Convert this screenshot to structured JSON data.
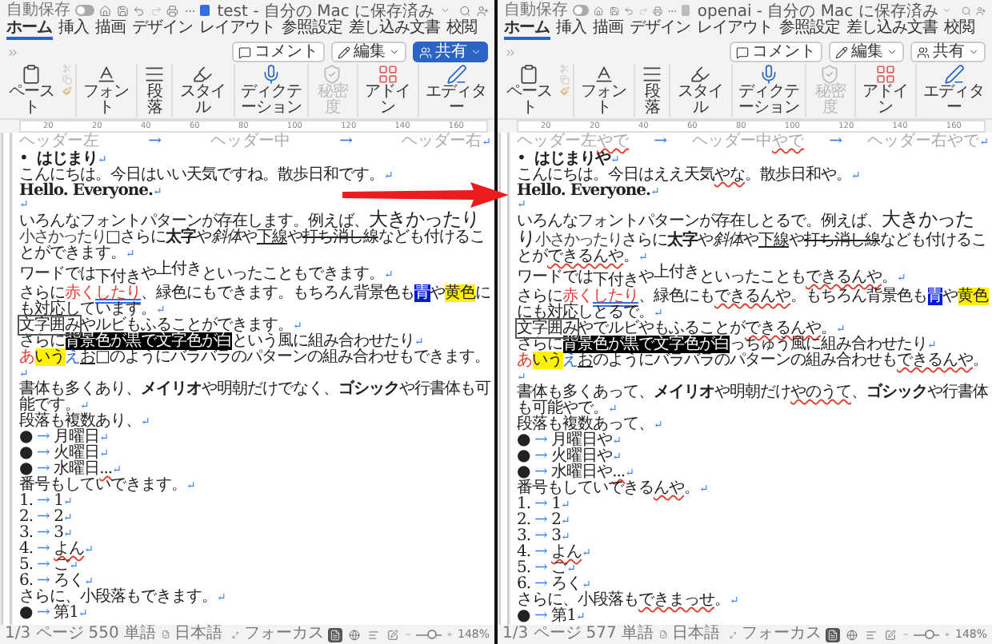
{
  "windows": [
    {
      "autosave_label": "自動保存",
      "autosave_on": false,
      "title": "test - 自分の Mac に保存済み",
      "title_icon_active": true,
      "tabs": [
        {
          "label": "ホーム",
          "selected": true
        },
        {
          "label": "挿入",
          "selected": false
        },
        {
          "label": "描画",
          "selected": false
        },
        {
          "label": "デザイン",
          "selected": false
        },
        {
          "label": "レイアウト",
          "selected": false
        },
        {
          "label": "参照設定",
          "selected": false
        },
        {
          "label": "差し込み文書",
          "selected": false
        },
        {
          "label": "校閲",
          "selected": false
        }
      ],
      "actions": [
        {
          "label": "コメント",
          "kind": "comment",
          "primary": false
        },
        {
          "label": "編集",
          "kind": "edit",
          "primary": false
        },
        {
          "label": "共有",
          "kind": "share",
          "primary": true
        }
      ],
      "ribbon": [
        {
          "label": "ペースト",
          "kind": "paste",
          "disabled": false
        },
        {
          "label": "フォント",
          "kind": "font",
          "disabled": false
        },
        {
          "label": "段落",
          "kind": "paragraph",
          "disabled": false
        },
        {
          "label": "スタイル",
          "kind": "styles",
          "disabled": false
        },
        {
          "label": "ディクテーション",
          "kind": "dictate",
          "disabled": false
        },
        {
          "label": "秘密度",
          "kind": "sensitivity",
          "disabled": true
        },
        {
          "label": "アドイン",
          "kind": "addins",
          "disabled": false
        },
        {
          "label": "エディター",
          "kind": "editor",
          "disabled": false
        }
      ],
      "ruler": [
        "20",
        "20",
        "40",
        "60",
        "80",
        "100",
        "120",
        "140",
        "160"
      ],
      "header": [
        {
          "runs": [
            {
              "text": "ヘッダー左"
            }
          ]
        },
        {
          "runs": [
            {
              "text": "→",
              "blue": true
            }
          ]
        },
        {
          "runs": [
            {
              "text": "ヘッダー中"
            }
          ]
        },
        {
          "runs": [
            {
              "text": "→",
              "blue": true
            }
          ]
        },
        {
          "runs": [
            {
              "text": "ヘッダー右"
            }
          ],
          "mark": "↵"
        }
      ],
      "paragraphs": [
        {
          "kind": "heading",
          "marker": "•",
          "runs": [
            {
              "text": "はじまり",
              "bold": true
            }
          ],
          "mark": "↵"
        },
        {
          "kind": "text",
          "runs": [
            {
              "text": "こんにちは。今日はいい天気ですね。散歩日和です。"
            }
          ],
          "mark": "↵"
        },
        {
          "kind": "text",
          "runs": [
            {
              "text": "Hello. Everyone.",
              "bold": true
            }
          ],
          "mark": "↵"
        },
        {
          "kind": "empty",
          "mark": "↵"
        },
        {
          "kind": "text",
          "runs": [
            {
              "text": "いろんなフォントパターンが存在します。例えば、"
            },
            {
              "text": "大きかったり",
              "big": true
            },
            {
              "text": "小さかったり",
              "small": true
            },
            {
              "text": "□さらに"
            },
            {
              "text": "太字",
              "bold": true
            },
            {
              "text": "や"
            },
            {
              "text": "斜体",
              "italic": true
            },
            {
              "text": "や"
            },
            {
              "text": "下線",
              "underline": true
            },
            {
              "text": "や"
            },
            {
              "text": "打ち消し線",
              "strike": true
            },
            {
              "text": "なども付けることができます。"
            }
          ],
          "mark": "↵"
        },
        {
          "kind": "text",
          "runs": [
            {
              "text": "ワードでは"
            },
            {
              "text": "下付き",
              "sub": true
            },
            {
              "text": "や"
            },
            {
              "text": "上付き",
              "sup": true
            },
            {
              "text": "といったこともできます。"
            }
          ],
          "mark": "↵"
        },
        {
          "kind": "text",
          "runs": [
            {
              "text": "さらに"
            },
            {
              "text": "赤く",
              "red": true
            },
            {
              "text": "したり",
              "red": true,
              "grammar": true
            },
            {
              "text": "、緑色にもできます。もちろん背景色も"
            },
            {
              "text": "青",
              "shade": true
            },
            {
              "text": "や"
            },
            {
              "text": "黄色",
              "highlight": true
            },
            {
              "text": "にも対応しています。"
            }
          ],
          "mark": "↵"
        },
        {
          "kind": "text",
          "runs": [
            {
              "text": "文字囲み",
              "boxed": true
            },
            {
              "text": "やルビもふることができます。"
            }
          ],
          "mark": "↵"
        },
        {
          "kind": "text",
          "runs": [
            {
              "text": "さらに"
            },
            {
              "text": "背景色が黒で文字色が白",
              "inverse": true
            },
            {
              "text": "という風に組み合わせたり"
            }
          ],
          "mark": "↵"
        },
        {
          "kind": "text",
          "runs": [
            {
              "text": "あ",
              "red": true
            },
            {
              "text": "いう",
              "highlight": true
            },
            {
              "text": "え",
              "blue": true
            },
            {
              "text": "お",
              "underline": true
            },
            {
              "text": "□のようにバラバラのパターンの組み合わせもできます。"
            }
          ],
          "mark": "↵"
        },
        {
          "kind": "text",
          "runs": [
            {
              "text": "書体も多くあり、"
            },
            {
              "text": "メイリオ",
              "sans": true
            },
            {
              "text": "や明朝だけでなく、"
            },
            {
              "text": "ゴシック",
              "sans": true
            },
            {
              "text": "や行書体も可能です。"
            }
          ],
          "mark": "↵"
        },
        {
          "kind": "text",
          "runs": [
            {
              "text": "段落も複数あり、"
            }
          ],
          "mark": "↵"
        },
        {
          "kind": "list",
          "marker": "●",
          "tab": "→",
          "runs": [
            {
              "text": "月曜日"
            }
          ],
          "mark": "↵"
        },
        {
          "kind": "list",
          "marker": "●",
          "tab": "→",
          "runs": [
            {
              "text": "火曜日"
            }
          ],
          "mark": "↵"
        },
        {
          "kind": "list",
          "marker": "●",
          "tab": "→",
          "runs": [
            {
              "text": "水曜日"
            },
            {
              "text": "...",
              "squiggle": true
            }
          ],
          "mark": "↵"
        },
        {
          "kind": "text",
          "runs": [
            {
              "text": "番号もしていできます。"
            }
          ],
          "mark": "↵"
        },
        {
          "kind": "list",
          "marker": "1.",
          "tab": "→",
          "runs": [
            {
              "text": "1"
            }
          ],
          "mark": "↵"
        },
        {
          "kind": "list",
          "marker": "2.",
          "tab": "→",
          "runs": [
            {
              "text": "2"
            }
          ],
          "mark": "↵"
        },
        {
          "kind": "list",
          "marker": "3.",
          "tab": "→",
          "runs": [
            {
              "text": "3"
            }
          ],
          "mark": "↵"
        },
        {
          "kind": "list",
          "marker": "4.",
          "tab": "→",
          "runs": [
            {
              "text": "よん",
              "squiggle": true
            }
          ],
          "mark": "↵"
        },
        {
          "kind": "list",
          "marker": "5.",
          "tab": "→",
          "runs": [
            {
              "text": "ご"
            }
          ],
          "mark": "↵"
        },
        {
          "kind": "list",
          "marker": "6.",
          "tab": "→",
          "runs": [
            {
              "text": "ろく"
            }
          ],
          "mark": "↵"
        },
        {
          "kind": "text",
          "runs": [
            {
              "text": "さらに、小段落もできます。"
            }
          ],
          "mark": "↵"
        },
        {
          "kind": "list",
          "marker": "●",
          "tab": "→",
          "runs": [
            {
              "text": "第1"
            }
          ],
          "mark": "↵"
        }
      ],
      "status": {
        "pages": "1/3 ページ",
        "words": "550 単語",
        "language": "日本語",
        "focus": "フォーカス",
        "views": [
          {
            "kind": "print",
            "selected": true
          },
          {
            "kind": "web",
            "selected": false
          },
          {
            "kind": "outline",
            "selected": false
          },
          {
            "kind": "draft",
            "selected": false
          }
        ],
        "zoom": {
          "level": 0.6,
          "reading": "148%"
        }
      }
    },
    {
      "autosave_label": "自動保存",
      "autosave_on": false,
      "title": "openai - 自分の Mac に保存済み",
      "title_icon_active": false,
      "tabs": [
        {
          "label": "ホーム",
          "selected": true
        },
        {
          "label": "挿入",
          "selected": false
        },
        {
          "label": "描画",
          "selected": false
        },
        {
          "label": "デザイン",
          "selected": false
        },
        {
          "label": "レイアウト",
          "selected": false
        },
        {
          "label": "参照設定",
          "selected": false
        },
        {
          "label": "差し込み文書",
          "selected": false
        },
        {
          "label": "校閲",
          "selected": false
        }
      ],
      "actions": [
        {
          "label": "コメント",
          "kind": "comment",
          "primary": false
        },
        {
          "label": "編集",
          "kind": "edit",
          "primary": false
        },
        {
          "label": "共有",
          "kind": "share",
          "primary": false
        }
      ],
      "ribbon": [
        {
          "label": "ペースト",
          "kind": "paste",
          "disabled": false
        },
        {
          "label": "フォント",
          "kind": "font",
          "disabled": false
        },
        {
          "label": "段落",
          "kind": "paragraph",
          "disabled": false
        },
        {
          "label": "スタイル",
          "kind": "styles",
          "disabled": false
        },
        {
          "label": "ディクテーション",
          "kind": "dictate",
          "disabled": false
        },
        {
          "label": "秘密度",
          "kind": "sensitivity",
          "disabled": true
        },
        {
          "label": "アドイン",
          "kind": "addins",
          "disabled": false
        },
        {
          "label": "エディター",
          "kind": "editor",
          "disabled": false
        }
      ],
      "ruler": [
        "20",
        "20",
        "40",
        "60",
        "80",
        "100",
        "120",
        "140",
        "160"
      ],
      "header": [
        {
          "runs": [
            {
              "text": "ヘッダー左"
            },
            {
              "text": "やで",
              "squiggle": true
            }
          ]
        },
        {
          "runs": [
            {
              "text": "→",
              "blue": true
            }
          ]
        },
        {
          "runs": [
            {
              "text": "ヘッダー中"
            },
            {
              "text": "やで",
              "squiggle": true
            }
          ]
        },
        {
          "runs": [
            {
              "text": "→",
              "blue": true
            }
          ]
        },
        {
          "runs": [
            {
              "text": "ヘッダー右やで"
            }
          ],
          "mark": "↵"
        }
      ],
      "paragraphs": [
        {
          "kind": "heading",
          "marker": "•",
          "runs": [
            {
              "text": "はじまりや",
              "bold": true
            }
          ],
          "mark": "↵"
        },
        {
          "kind": "text",
          "runs": [
            {
              "text": "こんにちは。今日はええ天気"
            },
            {
              "text": "やな",
              "squiggle": true
            },
            {
              "text": "。散歩日和や。"
            }
          ],
          "mark": "↵"
        },
        {
          "kind": "text",
          "runs": [
            {
              "text": "Hello. Everyone.",
              "bold": true
            }
          ],
          "mark": "↵"
        },
        {
          "kind": "empty",
          "mark": "↵"
        },
        {
          "kind": "text",
          "runs": [
            {
              "text": "いろんなフォントパターンが存在しとるで。例えば、"
            },
            {
              "text": "大きかったり",
              "big": true
            },
            {
              "text": "小さかったり",
              "small": true
            },
            {
              "text": "さらに"
            },
            {
              "text": "太字",
              "bold": true
            },
            {
              "text": "や"
            },
            {
              "text": "斜体",
              "italic": true
            },
            {
              "text": "や"
            },
            {
              "text": "下線",
              "underline": true
            },
            {
              "text": "や"
            },
            {
              "text": "打ち消し線",
              "strike": true
            },
            {
              "text": "なども付けることが"
            },
            {
              "text": "できるんや",
              "squiggle": true
            },
            {
              "text": "。"
            }
          ],
          "mark": "↵"
        },
        {
          "kind": "text",
          "runs": [
            {
              "text": "ワードでは"
            },
            {
              "text": "下付き",
              "sub": true
            },
            {
              "text": "や"
            },
            {
              "text": "上付き",
              "sup": true
            },
            {
              "text": "といったことも"
            },
            {
              "text": "できるんや",
              "squiggle": true
            },
            {
              "text": "。"
            }
          ],
          "mark": "↵"
        },
        {
          "kind": "text",
          "runs": [
            {
              "text": "さらに"
            },
            {
              "text": "赤く",
              "red": true
            },
            {
              "text": "したり",
              "red": true,
              "grammar": true
            },
            {
              "text": "、緑色にも"
            },
            {
              "text": "できるんや",
              "squiggle": true
            },
            {
              "text": "。もちろん背景色も"
            },
            {
              "text": "青",
              "shade": true
            },
            {
              "text": "や"
            },
            {
              "text": "黄色",
              "highlight": true
            },
            {
              "text": "にも対応しとるで。"
            }
          ],
          "mark": "↵"
        },
        {
          "kind": "text",
          "runs": [
            {
              "text": "文字囲み",
              "boxed": true
            },
            {
              "text": "やでルビやもふることが"
            },
            {
              "text": "できるんや",
              "squiggle": true
            },
            {
              "text": "。"
            }
          ],
          "mark": "↵"
        },
        {
          "kind": "text",
          "runs": [
            {
              "text": "さらに"
            },
            {
              "text": "背景色が黒で文字色が白",
              "inverse": true
            },
            {
              "text": "っちゅう風に組み合わせたり"
            }
          ],
          "mark": "↵"
        },
        {
          "kind": "text",
          "runs": [
            {
              "text": "あ",
              "red": true
            },
            {
              "text": "いう",
              "highlight": true
            },
            {
              "text": "え",
              "blue": true
            },
            {
              "text": "お",
              "underline": true
            },
            {
              "text": "のようにバラバラのパターンの組み合わせも"
            },
            {
              "text": "できるんや",
              "squiggle": true
            },
            {
              "text": "。"
            }
          ],
          "mark": "↵"
        },
        {
          "kind": "text",
          "runs": [
            {
              "text": "書体も多くあって、"
            },
            {
              "text": "メイリオ",
              "sans": true
            },
            {
              "text": "や明朝だけ"
            },
            {
              "text": "やのうて",
              "squiggle": true
            },
            {
              "text": "、"
            },
            {
              "text": "ゴシック",
              "sans": true
            },
            {
              "text": "や行書体も可能やで。"
            }
          ],
          "mark": "↵"
        },
        {
          "kind": "text",
          "runs": [
            {
              "text": "段落も複数あって、"
            }
          ],
          "mark": "↵"
        },
        {
          "kind": "list",
          "marker": "●",
          "tab": "→",
          "runs": [
            {
              "text": "月曜日や"
            }
          ],
          "mark": "↵"
        },
        {
          "kind": "list",
          "marker": "●",
          "tab": "→",
          "runs": [
            {
              "text": "火曜日や"
            }
          ],
          "mark": "↵"
        },
        {
          "kind": "list",
          "marker": "●",
          "tab": "→",
          "runs": [
            {
              "text": "水曜日や"
            },
            {
              "text": "...",
              "squiggle": true
            }
          ],
          "mark": "↵"
        },
        {
          "kind": "text",
          "runs": [
            {
              "text": "番号もしていできる"
            },
            {
              "text": "んや",
              "squiggle": true
            },
            {
              "text": "。"
            }
          ],
          "mark": "↵"
        },
        {
          "kind": "list",
          "marker": "1.",
          "tab": "→",
          "runs": [
            {
              "text": "1"
            }
          ],
          "mark": "↵"
        },
        {
          "kind": "list",
          "marker": "2.",
          "tab": "→",
          "runs": [
            {
              "text": "2"
            }
          ],
          "mark": "↵"
        },
        {
          "kind": "list",
          "marker": "3.",
          "tab": "→",
          "runs": [
            {
              "text": "3"
            }
          ],
          "mark": "↵"
        },
        {
          "kind": "list",
          "marker": "4.",
          "tab": "→",
          "runs": [
            {
              "text": "よん",
              "squiggle": true
            }
          ],
          "mark": "↵"
        },
        {
          "kind": "list",
          "marker": "5.",
          "tab": "→",
          "runs": [
            {
              "text": "ご"
            }
          ],
          "mark": "↵"
        },
        {
          "kind": "list",
          "marker": "6.",
          "tab": "→",
          "runs": [
            {
              "text": "ろく"
            }
          ],
          "mark": "↵"
        },
        {
          "kind": "text",
          "runs": [
            {
              "text": "さらに、小段落も"
            },
            {
              "text": "できまっせ",
              "squiggle": true
            },
            {
              "text": "。"
            }
          ],
          "mark": "↵"
        },
        {
          "kind": "list",
          "marker": "●",
          "tab": "→",
          "runs": [
            {
              "text": "第1"
            }
          ],
          "mark": "↵"
        }
      ],
      "status": {
        "pages": "1/3 ページ",
        "words": "577 単語",
        "language": "日本語",
        "focus": "フォーカス",
        "views": [
          {
            "kind": "print",
            "selected": true
          },
          {
            "kind": "web",
            "selected": false
          },
          {
            "kind": "outline",
            "selected": false
          },
          {
            "kind": "draft",
            "selected": false
          }
        ],
        "zoom": {
          "level": 0.6,
          "reading": "148%"
        }
      }
    }
  ]
}
